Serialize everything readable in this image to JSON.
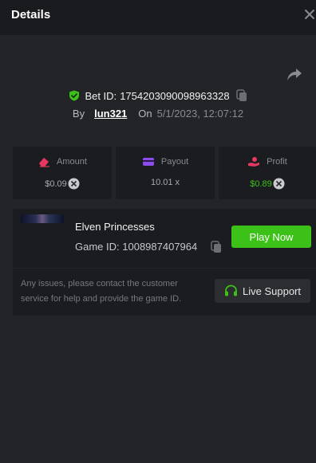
{
  "header": {
    "title": "Details",
    "close_icon": "close-icon"
  },
  "share_icon": "share-icon",
  "bet": {
    "id_label": "Bet ID:",
    "id_value": "1754203090098963328",
    "by_label": "By",
    "username": "lun321",
    "on_label": "On",
    "timestamp": "5/1/2023, 12:07:12"
  },
  "stats": {
    "amount": {
      "label": "Amount",
      "value": "$0.09",
      "icon": "eraser-icon",
      "icon_color": "#e8385f"
    },
    "payout": {
      "label": "Payout",
      "value": "10.01 x",
      "icon": "card-icon",
      "icon_color": "#8b4cf0"
    },
    "profit": {
      "label": "Profit",
      "value": "$0.89",
      "icon": "hand-coin-icon",
      "icon_color": "#e8385f",
      "value_color": "#3bc117"
    }
  },
  "game": {
    "name": "Elven Princesses",
    "id_label": "Game ID:",
    "id_value": "1008987407964",
    "play_label": "Play Now"
  },
  "support": {
    "message": "Any issues, please contact the customer service for help and provide the game ID.",
    "button_label": "Live Support",
    "icon": "headset-icon"
  },
  "colors": {
    "accent_green": "#3bc117",
    "background": "#232427",
    "panel": "#1b1c1f"
  }
}
